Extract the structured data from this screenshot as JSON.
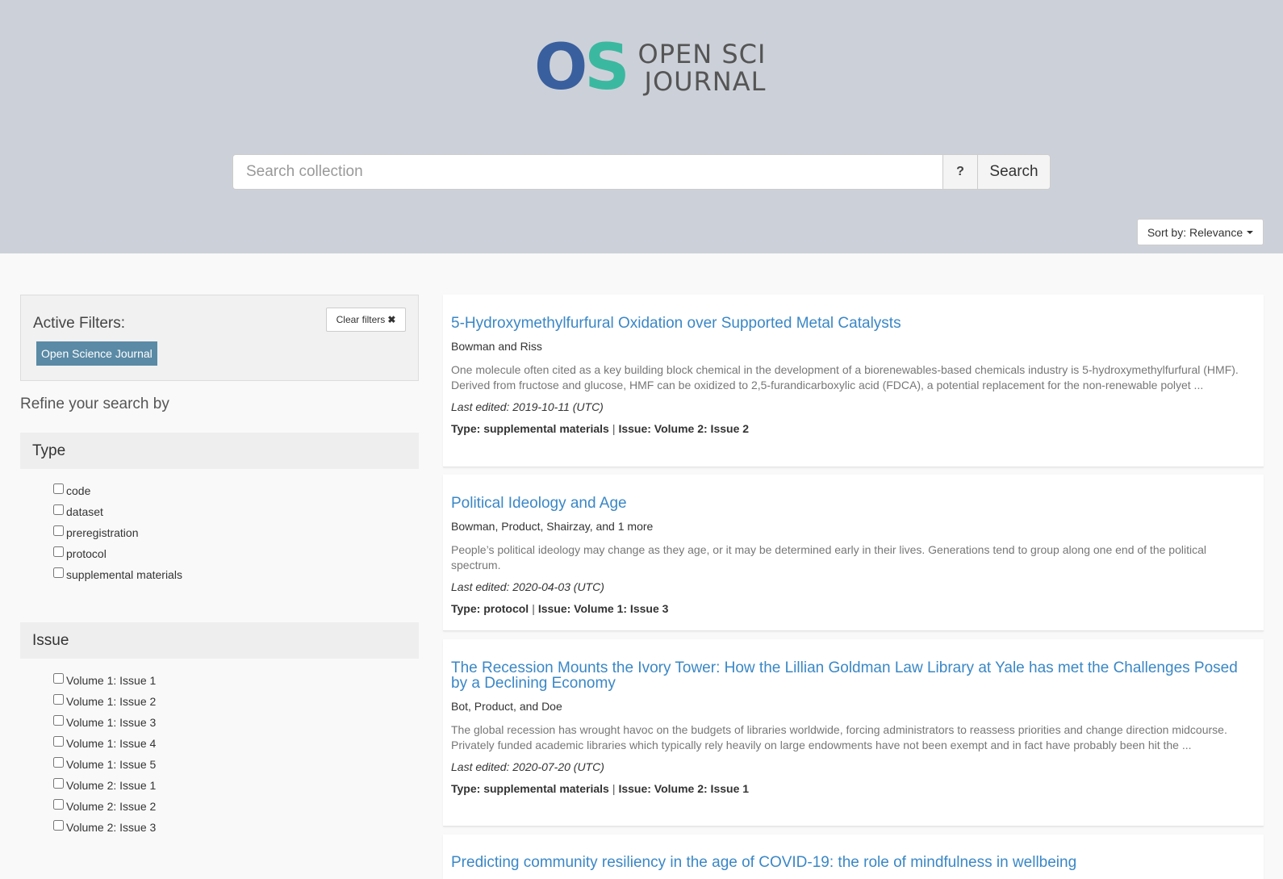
{
  "logo": {
    "mark_o": "O",
    "mark_s": "S",
    "line1": "OPEN SCI",
    "line2": "JOURNAL"
  },
  "search": {
    "placeholder": "Search collection",
    "help_label": "?",
    "button_label": "Search"
  },
  "sort": {
    "label": "Sort by: Relevance"
  },
  "active_filters": {
    "title": "Active Filters:",
    "clear_label": "Clear filters",
    "clear_icon": "✖",
    "tags": [
      "Open Science Journal"
    ]
  },
  "refine_label": "Refine your search by",
  "facets": {
    "type": {
      "title": "Type",
      "options": [
        "code",
        "dataset",
        "preregistration",
        "protocol",
        "supplemental materials"
      ]
    },
    "issue": {
      "title": "Issue",
      "options": [
        "Volume 1: Issue 1",
        "Volume 1: Issue 2",
        "Volume 1: Issue 3",
        "Volume 1: Issue 4",
        "Volume 1: Issue 5",
        "Volume 2: Issue 1",
        "Volume 2: Issue 2",
        "Volume 2: Issue 3"
      ]
    }
  },
  "results": [
    {
      "title": "5-Hydroxymethylfurfural Oxidation over Supported Metal Catalysts",
      "authors": "Bowman and Riss",
      "abstract": "One molecule often cited as a key building block chemical in the development of a biorenewables-based chemicals industry is 5-hydroxymethylfurfural (HMF). Derived from fructose and glucose, HMF can be oxidized to 2,5-furandicarboxylic acid (FDCA), a potential replacement for the non-renewable polyet ...",
      "edited": "Last edited: 2019-10-11 (UTC)",
      "type": "Type: supplemental materials",
      "separator": "|",
      "issue": "Issue: Volume 2: Issue 2"
    },
    {
      "title": "Political Ideology and Age",
      "authors": "Bowman, Product, Shairzay, and 1 more",
      "abstract": "People’s political ideology may change as they age, or it may be determined early in their lives. Generations tend to group along one end of the political spectrum.",
      "edited": "Last edited: 2020-04-03 (UTC)",
      "type": "Type: protocol",
      "separator": "|",
      "issue": "Issue: Volume 1: Issue 3"
    },
    {
      "title": "The Recession Mounts the Ivory Tower: How the Lillian Goldman Law Library at Yale has met the Challenges Posed by a Declining Economy",
      "authors": "Bot, Product, and Doe",
      "abstract": "The global recession has wrought havoc on the budgets of libraries worldwide, forcing administrators to reassess priorities and change direction midcourse. Privately funded academic libraries which typically rely heavily on large endowments have not been exempt and in fact have probably been hit the ...",
      "edited": "Last edited: 2020-07-20 (UTC)",
      "type": "Type: supplemental materials",
      "separator": "|",
      "issue": "Issue: Volume 2: Issue 1"
    },
    {
      "title": "Predicting community resiliency in the age of COVID-19: the role of mindfulness in wellbeing"
    }
  ]
}
